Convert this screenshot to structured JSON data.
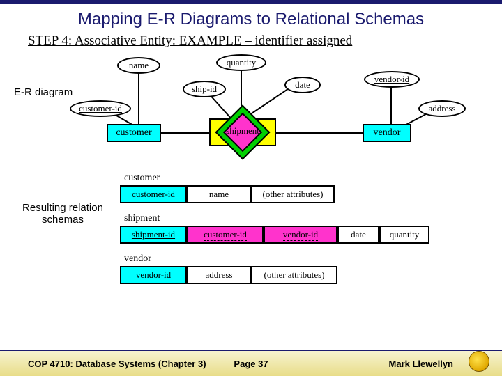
{
  "title": "Mapping E-R Diagrams to Relational Schemas",
  "subtitle": "STEP 4:  Associative Entity: EXAMPLE – identifier assigned",
  "labels": {
    "er": "E-R diagram",
    "resulting": "Resulting relation schemas"
  },
  "er": {
    "attrs": {
      "name": "name",
      "quantity": "quantity",
      "ship_id": "ship-id",
      "date": "date",
      "vendor_id": "vendor-id",
      "customer_id": "customer-id",
      "address": "address"
    },
    "entities": {
      "customer": "customer",
      "shipment": "shipment",
      "vendor": "vendor"
    }
  },
  "tables": {
    "customer": {
      "title": "customer",
      "cols": [
        "customer-id",
        "name",
        "(other attributes)"
      ]
    },
    "shipment": {
      "title": "shipment",
      "cols": [
        "shipment-id",
        "customer-id",
        "vendor-id",
        "date",
        "quantity"
      ]
    },
    "vendor": {
      "title": "vendor",
      "cols": [
        "vendor-id",
        "address",
        "(other attributes)"
      ]
    }
  },
  "footer": {
    "course": "COP 4710: Database Systems  (Chapter 3)",
    "page": "Page 37",
    "author": "Mark Llewellyn"
  }
}
